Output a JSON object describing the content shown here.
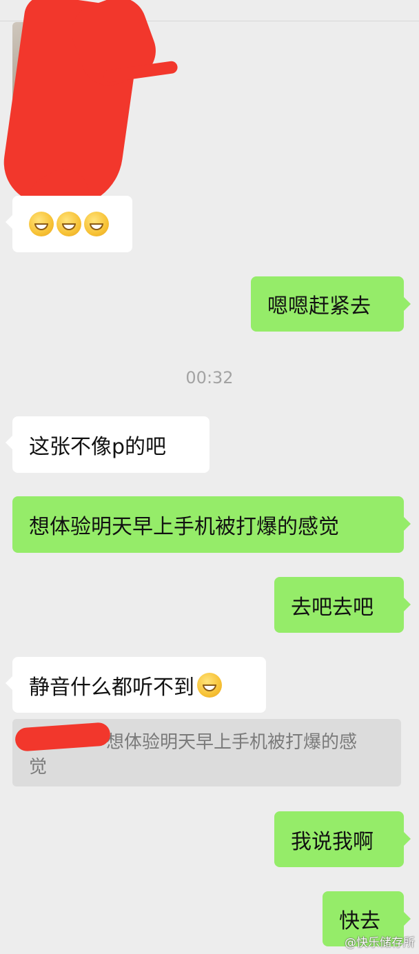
{
  "chat": {
    "messages": [
      {
        "side": "left",
        "type": "emoji",
        "emojis": [
          "grin-emoji",
          "grin-emoji",
          "grin-emoji"
        ]
      },
      {
        "side": "right",
        "text": "嗯嗯赶紧去"
      },
      {
        "side": "center",
        "type": "time",
        "text": "00:32"
      },
      {
        "side": "left",
        "text": "这张不像p的吧"
      },
      {
        "side": "right",
        "text": "想体验明天早上手机被打爆的感觉"
      },
      {
        "side": "right",
        "text": "去吧去吧"
      },
      {
        "side": "left",
        "text": "静音什么都听不到",
        "emoji": "grin-emoji"
      },
      {
        "side": "quote",
        "text": "想体验明天早上手机被打爆的感",
        "text_line2": "觉"
      },
      {
        "side": "right",
        "text": "我说我啊"
      },
      {
        "side": "right",
        "text": "快去"
      }
    ]
  },
  "watermark": {
    "text": "@快乐储存所"
  },
  "colors": {
    "background": "#ededed",
    "incoming_bubble": "#ffffff",
    "outgoing_bubble": "#95ec69",
    "redaction": "#f2372c"
  }
}
